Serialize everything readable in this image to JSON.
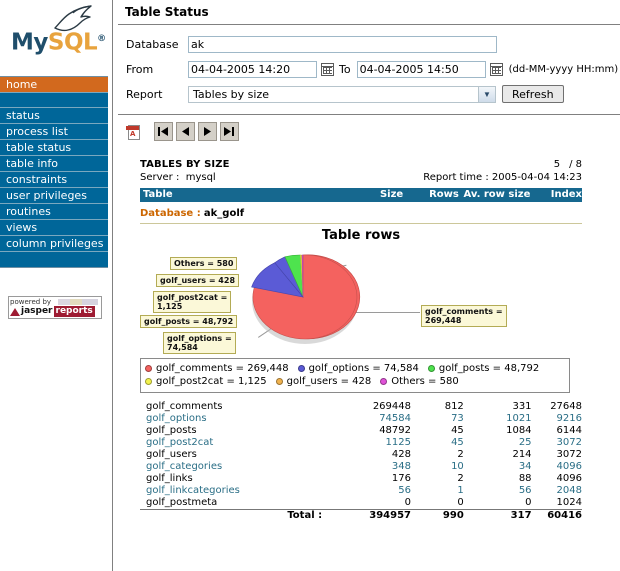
{
  "sidebar": {
    "logo": {
      "my": "My",
      "sql": "SQL",
      "reg": "®",
      "alt": "MySQL"
    },
    "nav_items": [
      {
        "label": "home",
        "active": true
      },
      {
        "label": "",
        "spacer": true
      },
      {
        "label": "status"
      },
      {
        "label": "process list"
      },
      {
        "label": "table status"
      },
      {
        "label": "table info"
      },
      {
        "label": "constraints"
      },
      {
        "label": "user privileges"
      },
      {
        "label": "routines"
      },
      {
        "label": "views"
      },
      {
        "label": "column privileges"
      },
      {
        "label": "",
        "spacer": true
      }
    ],
    "powered_by": {
      "prefix": "powered by",
      "jasper": "jasper",
      "reports": "reports"
    }
  },
  "header": {
    "title": "Table Status"
  },
  "form": {
    "database_label": "Database",
    "database_value": "ak",
    "from_label": "From",
    "from_value": "04-04-2005 14:20",
    "to_label": "To",
    "to_value": "04-04-2005 14:50",
    "format_hint": "(dd-MM-yyyy HH:mm)",
    "report_label": "Report",
    "report_value": "Tables by size",
    "report_options": [
      "Tables by size"
    ],
    "refresh_label": "Refresh"
  },
  "toolbar": {
    "pdf_label": "PDF",
    "first_label": "First page",
    "prev_label": "Previous page",
    "next_label": "Next page",
    "last_label": "Last page"
  },
  "report": {
    "title": "TABLES BY SIZE",
    "server_label": "Server :",
    "server_value": "mysql",
    "page_current": "5",
    "page_total": "/ 8",
    "report_time_label": "Report time :",
    "report_time_value": "2005-04-04 14:23",
    "columns": [
      "Table",
      "Size",
      "Rows",
      "Av. row size",
      "Index size"
    ],
    "database_label": "Database :",
    "database_value": "ak_golf"
  },
  "chart_data": {
    "type": "pie",
    "title": "Table rows",
    "categories": [
      "golf_comments",
      "golf_options",
      "golf_posts",
      "golf_post2cat",
      "golf_users",
      "Others"
    ],
    "values": [
      269448,
      74584,
      48792,
      1125,
      428,
      580
    ],
    "value_labels": [
      "269,448",
      "74,584",
      "48,792",
      "1,125",
      "428",
      "580"
    ],
    "colors": [
      "#f4625f",
      "#5b5bd6",
      "#4ee34e",
      "#f2f24d",
      "#f0b24e",
      "#e052d8"
    ],
    "legend_position": "bottom",
    "legend_entries": [
      "golf_comments = 269,448",
      "golf_options = 74,584",
      "golf_posts = 48,792",
      "golf_post2cat = 1,125",
      "golf_users = 428",
      "Others = 580"
    ],
    "callouts": [
      "Others = 580",
      "golf_users = 428",
      "golf_post2cat =\n1,125",
      "golf_posts = 48,792",
      "golf_options =\n74,584",
      "golf_comments =\n269,448"
    ]
  },
  "table": {
    "rows": [
      {
        "name": "golf_comments",
        "size": "269448",
        "rows": "812",
        "avg": "331",
        "index": "27648"
      },
      {
        "name": "golf_options",
        "size": "74584",
        "rows": "73",
        "avg": "1021",
        "index": "9216"
      },
      {
        "name": "golf_posts",
        "size": "48792",
        "rows": "45",
        "avg": "1084",
        "index": "6144"
      },
      {
        "name": "golf_post2cat",
        "size": "1125",
        "rows": "45",
        "avg": "25",
        "index": "3072"
      },
      {
        "name": "golf_users",
        "size": "428",
        "rows": "2",
        "avg": "214",
        "index": "3072"
      },
      {
        "name": "golf_categories",
        "size": "348",
        "rows": "10",
        "avg": "34",
        "index": "4096"
      },
      {
        "name": "golf_links",
        "size": "176",
        "rows": "2",
        "avg": "88",
        "index": "4096"
      },
      {
        "name": "golf_linkcategories",
        "size": "56",
        "rows": "1",
        "avg": "56",
        "index": "2048"
      },
      {
        "name": "golf_postmeta",
        "size": "0",
        "rows": "0",
        "avg": "0",
        "index": "1024"
      }
    ],
    "total_label": "Total :",
    "total": {
      "size": "394957",
      "rows": "990",
      "avg": "317",
      "index": "60416"
    }
  }
}
